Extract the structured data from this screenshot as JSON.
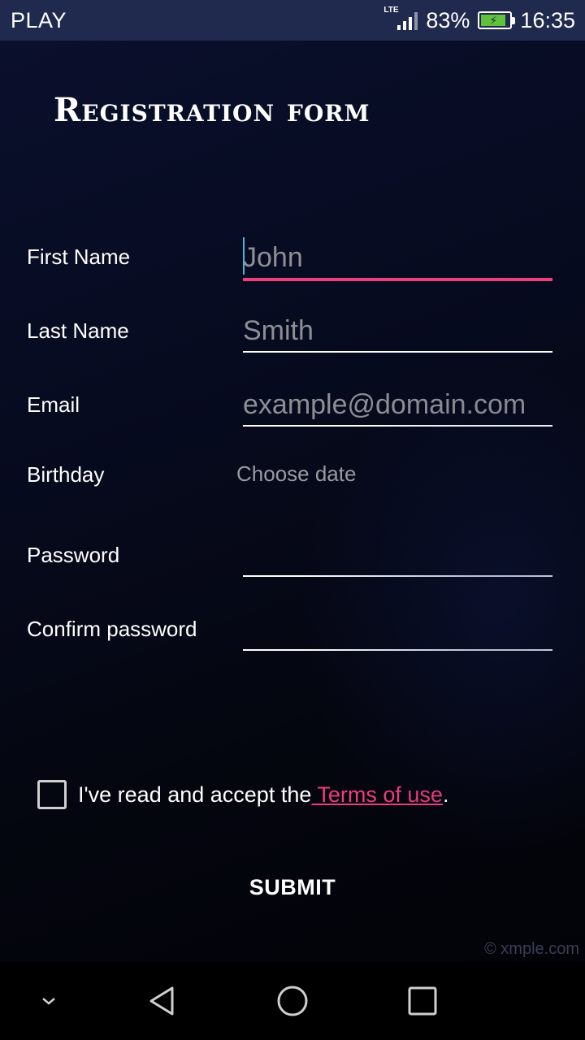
{
  "status_bar": {
    "carrier": "PLAY",
    "network_type": "LTE",
    "battery_percent": "83%",
    "time": "16:35",
    "battery_fill_color": "#5fc13d"
  },
  "form": {
    "title": "Registration form",
    "fields": {
      "first_name": {
        "label": "First Name",
        "placeholder": "John",
        "value": ""
      },
      "last_name": {
        "label": "Last Name",
        "placeholder": "Smith",
        "value": ""
      },
      "email": {
        "label": "Email",
        "placeholder": "example@domain.com",
        "value": ""
      },
      "birthday": {
        "label": "Birthday",
        "placeholder": "Choose date"
      },
      "password": {
        "label": "Password",
        "value": ""
      },
      "confirm_password": {
        "label": "Confirm password",
        "value": ""
      }
    },
    "terms": {
      "checked": false,
      "text": "I've read and accept the",
      "link": " Terms of use",
      "suffix": "."
    },
    "submit_label": "SUBMIT",
    "watermark": "© xmple.com"
  },
  "colors": {
    "accent": "#ef3d7b",
    "status_bar_bg": "#1f2a4e",
    "cursor": "#49b4d1"
  },
  "nav_bar": {
    "icons": [
      "chevron-down-icon",
      "back-icon",
      "home-icon",
      "recents-icon"
    ]
  }
}
